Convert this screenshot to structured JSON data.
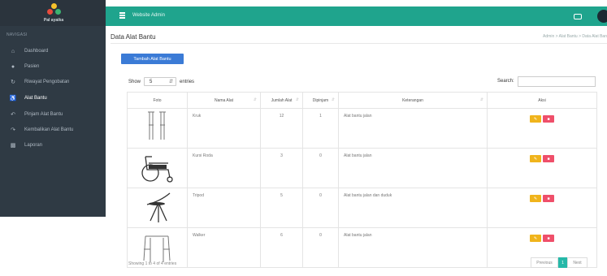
{
  "sidebar": {
    "logo_text": "Pal ayaika",
    "section": "NAVIGASI",
    "items": [
      {
        "label": "Dashboard",
        "icon": "home-icon",
        "active": false
      },
      {
        "label": "Pasien",
        "icon": "user-icon",
        "active": false
      },
      {
        "label": "Riwayat Pengobatan",
        "icon": "history-icon",
        "active": false
      },
      {
        "label": "Alat Bantu",
        "icon": "wheelchair-icon",
        "active": true
      },
      {
        "label": "Pinjam Alat Bantu",
        "icon": "reply-icon",
        "active": false
      },
      {
        "label": "Kembalikan Alat Bantu",
        "icon": "share-icon",
        "active": false
      },
      {
        "label": "Laporan",
        "icon": "car-icon",
        "active": false
      }
    ]
  },
  "topbar": {
    "brand": "Website  Admin",
    "color": "#1fa48d"
  },
  "page": {
    "title": "Data Alat Bantu",
    "breadcrumb": "Admin  >  Alat Bantu  >  Data Alat Ban"
  },
  "toolbar": {
    "add_label": "Tambah Alat Bantu",
    "show_label": "Show",
    "entries_value": "5",
    "entries_label": "entries",
    "search_label": "Search:",
    "search_value": ""
  },
  "table": {
    "headers": [
      "Foto",
      "Nama Alat",
      "Jumlah Alat",
      "Dipinjam",
      "Keterangan",
      "Aksi"
    ],
    "rows": [
      {
        "nama": "Kruk",
        "jumlah": "12",
        "dipinjam": "1",
        "keterangan": "Alat bantu jalan",
        "image": "crutches-image"
      },
      {
        "nama": "Kursi Roda",
        "jumlah": "3",
        "dipinjam": "0",
        "keterangan": "Alat bantu jalan",
        "image": "wheelchair-image"
      },
      {
        "nama": "Tripod",
        "jumlah": "5",
        "dipinjam": "0",
        "keterangan": "Alat bantu jalan dan duduk",
        "image": "tripod-cane-image"
      },
      {
        "nama": "Walker",
        "jumlah": "6",
        "dipinjam": "0",
        "keterangan": "Alat bantu jalan",
        "image": "walker-image"
      }
    ],
    "edit_icon": "pencil-icon",
    "delete_icon": "trash-icon"
  },
  "footer": {
    "showing": "Showing 1 to 4 of 4 entries",
    "prev": "Previous",
    "page": "1",
    "next": "Next"
  },
  "colors": {
    "sidebar": "#2f3a44",
    "accent": "#1fa48d",
    "primary_button": "#3b7bd6",
    "edit": "#f0b41c",
    "delete": "#ef4f6a"
  }
}
